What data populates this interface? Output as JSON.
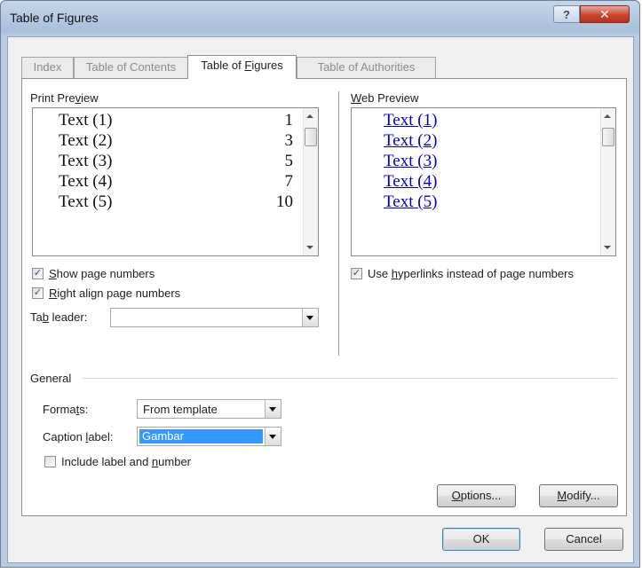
{
  "window": {
    "title": "Table of Figures",
    "help_label": "?",
    "close_label": "✕"
  },
  "tabs": [
    {
      "label": "Index",
      "active": false
    },
    {
      "label": "Table of Contents",
      "active": false
    },
    {
      "label": "Table of Figures",
      "active": true,
      "underline_char": "F"
    },
    {
      "label": "Table of Authorities",
      "active": false
    }
  ],
  "print_preview": {
    "label_pre": "Print Pre",
    "label_ul": "v",
    "label_post": "iew",
    "entries": [
      {
        "text": "Text (1)",
        "page": "1"
      },
      {
        "text": "Text (2)",
        "page": "3"
      },
      {
        "text": "Text (3)",
        "page": "5"
      },
      {
        "text": "Text (4)",
        "page": "7"
      },
      {
        "text": "Text (5)",
        "page": "10"
      }
    ]
  },
  "web_preview": {
    "label_ul": "W",
    "label_post": "eb Preview",
    "entries": [
      "Text (1)",
      "Text (2)",
      "Text (3)",
      "Text (4)",
      "Text (5)"
    ]
  },
  "options": {
    "show_page_numbers": {
      "checked": true,
      "ul": "S",
      "rest": "how page numbers"
    },
    "right_align": {
      "checked": true,
      "ul": "R",
      "rest": "ight align page numbers"
    },
    "use_hyperlinks": {
      "checked": true,
      "pre": "Use ",
      "ul": "h",
      "rest": "yperlinks instead of page numbers"
    },
    "tab_leader": {
      "pre": "Ta",
      "ul": "b",
      "rest": " leader:",
      "value": ""
    }
  },
  "general": {
    "heading": "General",
    "formats": {
      "pre": "Forma",
      "ul": "t",
      "rest": "s:",
      "value": "From template"
    },
    "caption_label": {
      "pre": "Caption ",
      "ul": "l",
      "rest": "abel:",
      "value": "Gambar"
    },
    "include_label": {
      "checked": false,
      "pre": "Include label and ",
      "ul": "n",
      "rest": "umber"
    }
  },
  "buttons": {
    "options": {
      "ul": "O",
      "rest": "ptions..."
    },
    "modify": {
      "ul": "M",
      "rest": "odify..."
    },
    "ok": "OK",
    "cancel": "Cancel"
  }
}
